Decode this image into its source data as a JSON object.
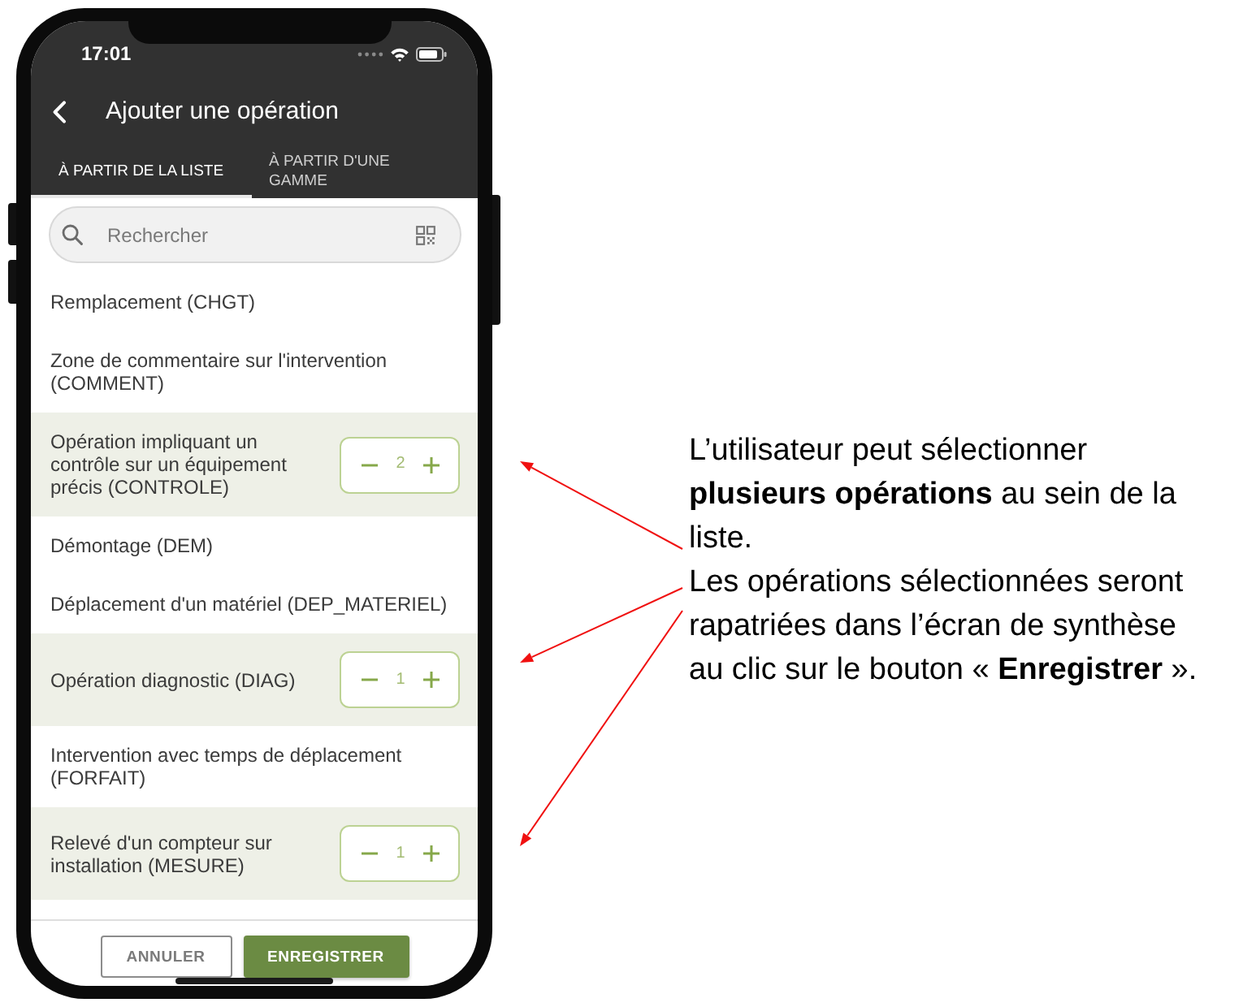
{
  "status_bar": {
    "time": "17:01"
  },
  "app_bar": {
    "title": "Ajouter une opération"
  },
  "tabs": [
    {
      "label": "À PARTIR DE LA LISTE",
      "selected": true
    },
    {
      "label": "À PARTIR D'UNE GAMME",
      "selected": false
    }
  ],
  "search": {
    "placeholder": "Rechercher"
  },
  "operations": [
    {
      "label": "Remplacement (CHGT)",
      "selected": false
    },
    {
      "label": "Zone de commentaire sur l'intervention (COMMENT)",
      "selected": false
    },
    {
      "label": "Opération impliquant un contrôle sur un équipement précis (CONTROLE)",
      "selected": true,
      "quantity": "2"
    },
    {
      "label": "Démontage (DEM)",
      "selected": false
    },
    {
      "label": "Déplacement d'un matériel (DEP_MATERIEL)",
      "selected": false
    },
    {
      "label": "Opération diagnostic (DIAG)",
      "selected": true,
      "quantity": "1"
    },
    {
      "label": "Intervention avec temps de déplacement (FORFAIT)",
      "selected": false
    },
    {
      "label": "Relevé d'un compteur sur installation (MESURE)",
      "selected": true,
      "quantity": "1"
    }
  ],
  "buttons": [
    {
      "label": "ANNULER",
      "kind": "outlined"
    },
    {
      "label": "ENREGISTRER",
      "kind": "filled"
    }
  ],
  "annotation": {
    "paragraphs": [
      "L’utilisateur peut sélectionner **plusieurs opérations** au sein de la liste.",
      "Les opérations sélectionnées seront rapatriées dans l’écran de synthèse au clic sur le bouton « **Enregistrer** »."
    ]
  }
}
